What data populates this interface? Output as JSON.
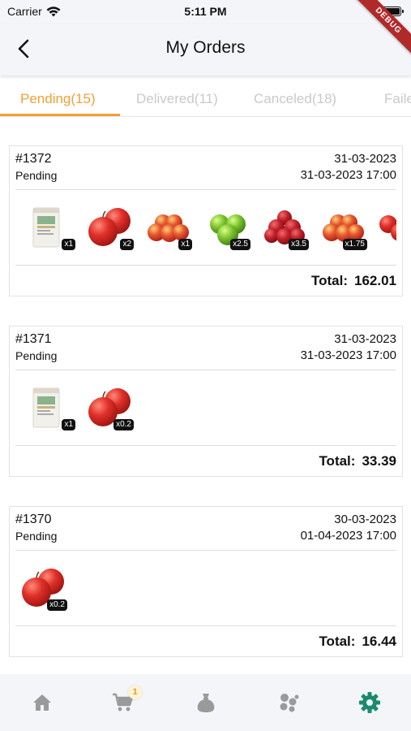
{
  "status_bar": {
    "carrier": "Carrier",
    "time": "5:11 PM"
  },
  "debug_label": "DEBUG",
  "app_bar": {
    "title": "My Orders"
  },
  "tabs": [
    {
      "label": "Pending(15)",
      "active": true
    },
    {
      "label": "Delivered(11)",
      "active": false
    },
    {
      "label": "Canceled(18)",
      "active": false
    },
    {
      "label": "Faile",
      "active": false
    }
  ],
  "total_label": "Total:",
  "orders": [
    {
      "id": "#1372",
      "status": "Pending",
      "date": "31-03-2023",
      "delivery": "31-03-2023 17:00",
      "items": [
        {
          "type": "package",
          "qty": "x1"
        },
        {
          "type": "red-apple",
          "qty": "x2"
        },
        {
          "type": "apple-pile",
          "qty": "x1"
        },
        {
          "type": "green-apple",
          "qty": "x2.5"
        },
        {
          "type": "red-pile",
          "qty": "x3.5"
        },
        {
          "type": "apple-pile",
          "qty": "x1.75"
        },
        {
          "type": "red-apple-partial",
          "qty": ""
        }
      ],
      "total": "162.01"
    },
    {
      "id": "#1371",
      "status": "Pending",
      "date": "31-03-2023",
      "delivery": "31-03-2023 17:00",
      "items": [
        {
          "type": "package",
          "qty": "x1"
        },
        {
          "type": "red-apple",
          "qty": "x0.2"
        }
      ],
      "total": "33.39"
    },
    {
      "id": "#1370",
      "status": "Pending",
      "date": "30-03-2023",
      "delivery": "01-04-2023 17:00",
      "items": [
        {
          "type": "red-apple",
          "qty": "x0.2"
        }
      ],
      "total": "16.44"
    }
  ],
  "bottom_nav": {
    "items": [
      "home-icon",
      "cart-icon",
      "bag-icon",
      "categories-icon",
      "settings-icon"
    ],
    "cart_badge": "1",
    "active_color": "#1a8a6e",
    "inactive_color": "#9a9a9a"
  },
  "colors": {
    "accent": "#f0a035"
  }
}
